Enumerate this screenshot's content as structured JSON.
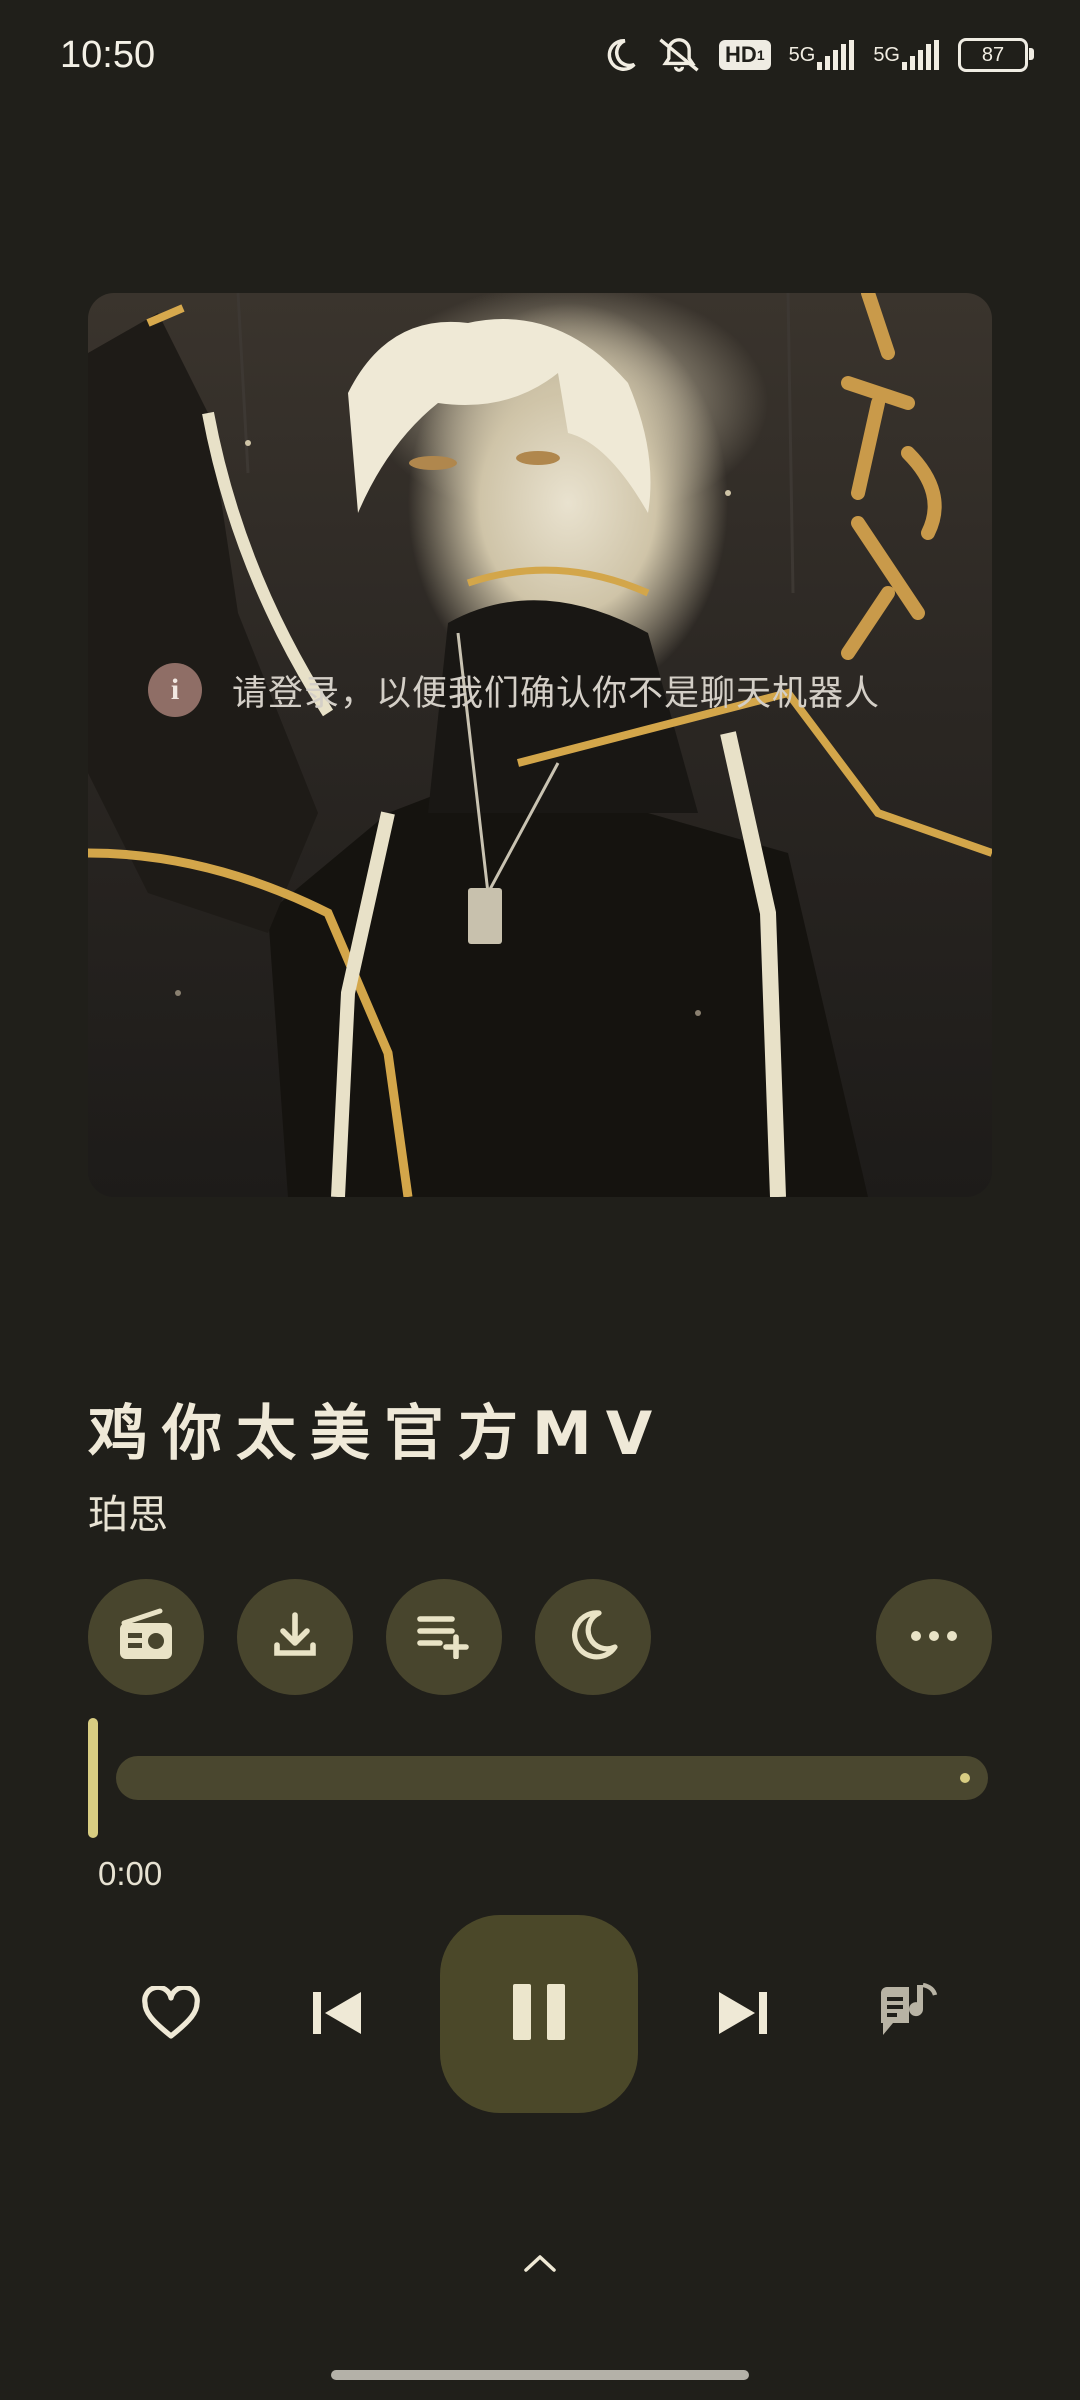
{
  "status_bar": {
    "time": "10:50",
    "icons": [
      "moon-icon",
      "mute-icon",
      "hd-icon",
      "signal-5g-1-icon",
      "signal-5g-2-icon",
      "battery-icon"
    ],
    "hd_label": "HD",
    "hd_sub": "1",
    "net1": "5G",
    "net2": "5G",
    "battery": "87"
  },
  "album": {
    "overlay_text": "请登录，以便我们确认你不是聊天机器人",
    "info_glyph": "i"
  },
  "song": {
    "title": "鸡你太美官方MV",
    "artist": "珀思"
  },
  "actions": [
    {
      "name": "radio-button",
      "icon": "radio-icon"
    },
    {
      "name": "download-button",
      "icon": "download-icon"
    },
    {
      "name": "add-to-playlist-button",
      "icon": "playlist-add-icon"
    },
    {
      "name": "sleep-timer-button",
      "icon": "moon-icon"
    },
    {
      "name": "more-button",
      "icon": "more-horizontal-icon"
    }
  ],
  "progress": {
    "current_time": "0:00",
    "fraction": 0
  },
  "controls": {
    "state": "playing",
    "buttons": [
      "favorite-button",
      "previous-button",
      "pause-button",
      "next-button",
      "lyrics-button"
    ]
  },
  "colors": {
    "background": "#201f1a",
    "accent": "#d8cd82",
    "button_bg": "#48452d",
    "text": "#f1ecd9"
  }
}
